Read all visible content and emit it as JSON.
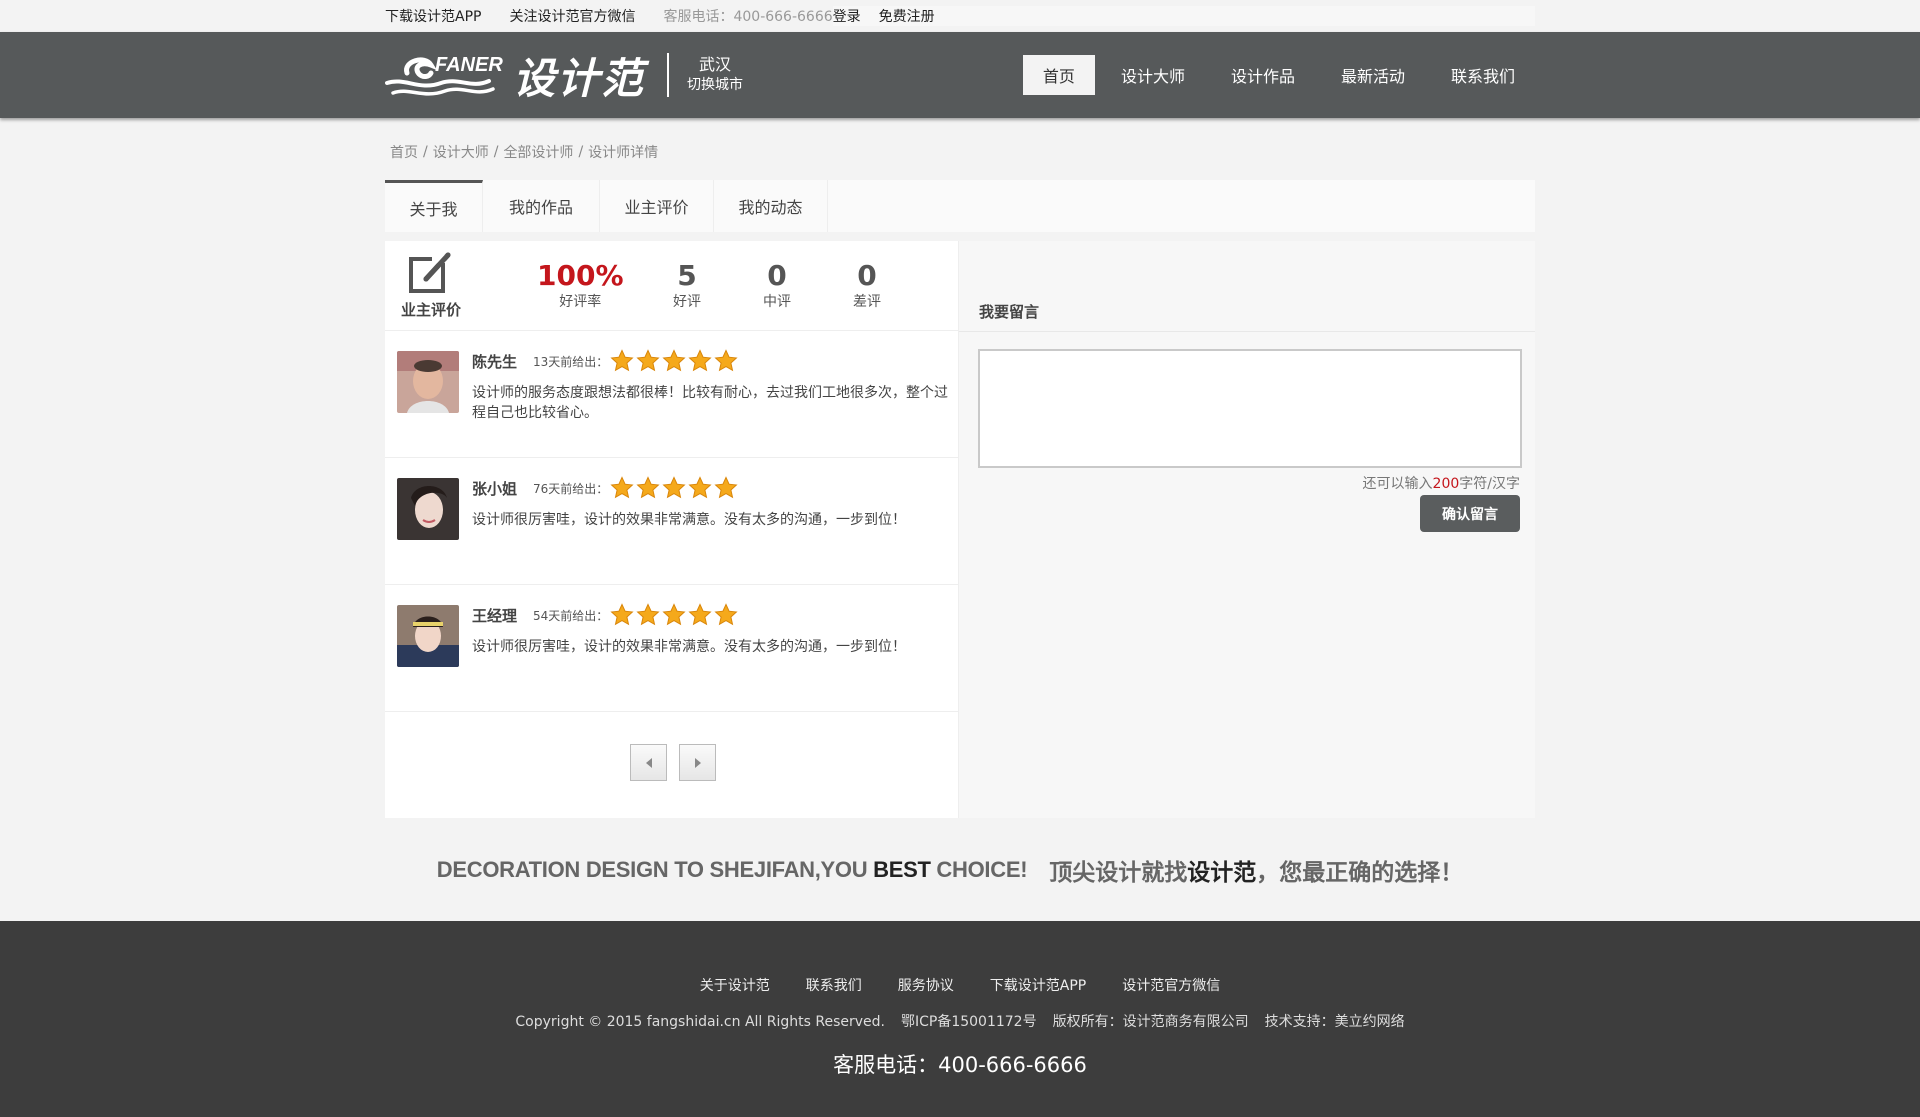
{
  "topbar": {
    "download_app": "下载设计范APP",
    "follow_wechat": "关注设计范官方微信",
    "service_phone": "客服电话：400-666-6666",
    "login": "登录",
    "register": "免费注册"
  },
  "header": {
    "logo_en": "FANER",
    "logo_cn": "设计范",
    "city": "武汉",
    "switch_city": "切换城市",
    "nav": [
      "首页",
      "设计大师",
      "设计作品",
      "最新活动",
      "联系我们"
    ]
  },
  "breadcrumb": [
    "首页",
    "设计大师",
    "全部设计师",
    "设计师详情"
  ],
  "breadcrumb_sep": "/",
  "tabs": [
    "关于我",
    "我的作品",
    "业主评价",
    "我的动态"
  ],
  "stats": {
    "section_label": "业主评价",
    "rate": "100%",
    "rate_label": "好评率",
    "good": "5",
    "good_label": "好评",
    "mid": "0",
    "mid_label": "中评",
    "bad": "0",
    "bad_label": "差评"
  },
  "reviews": [
    {
      "name": "陈先生",
      "time": "13天前给出：",
      "stars": 5,
      "text": "设计师的服务态度跟想法都很棒！比较有耐心，去过我们工地很多次，整个过程自己也比较省心。"
    },
    {
      "name": "张小姐",
      "time": "76天前给出：",
      "stars": 5,
      "text": "设计师很厉害哇，设计的效果非常满意。没有太多的沟通，一步到位！"
    },
    {
      "name": "王经理",
      "time": "54天前给出：",
      "stars": 5,
      "text": "设计师很厉害哇，设计的效果非常满意。没有太多的沟通，一步到位！"
    }
  ],
  "message": {
    "title": "我要留言",
    "count_prefix": "还可以输入",
    "count_value": "200",
    "count_suffix": "字符/汉字",
    "submit": "确认留言"
  },
  "slogan": {
    "en_pre": "DECORATION DESIGN TO SHEJIFAN,YOU ",
    "en_bold": "BEST",
    "en_post": " CHOICE!",
    "cn_pre": "顶尖设计就找",
    "cn_bold": "设计范",
    "cn_post": "，您最正确的选择！"
  },
  "footer": {
    "links": [
      "关于设计范",
      "联系我们",
      "服务协议",
      "下载设计范APP",
      "设计范官方微信"
    ],
    "copyright": "Copyright © 2015 fangshidai.cn All Rights Reserved.",
    "icp": "鄂ICP备15001172号",
    "owner": "版权所有：设计范商务有限公司",
    "support": "技术支持：美立约网络",
    "phone": "客服电话：400-666-6666"
  },
  "colors": {
    "header_bg": "#56595a",
    "accent_red": "#c4161c",
    "footer_bg": "#3d3d3d",
    "star": "#f5a91b"
  }
}
